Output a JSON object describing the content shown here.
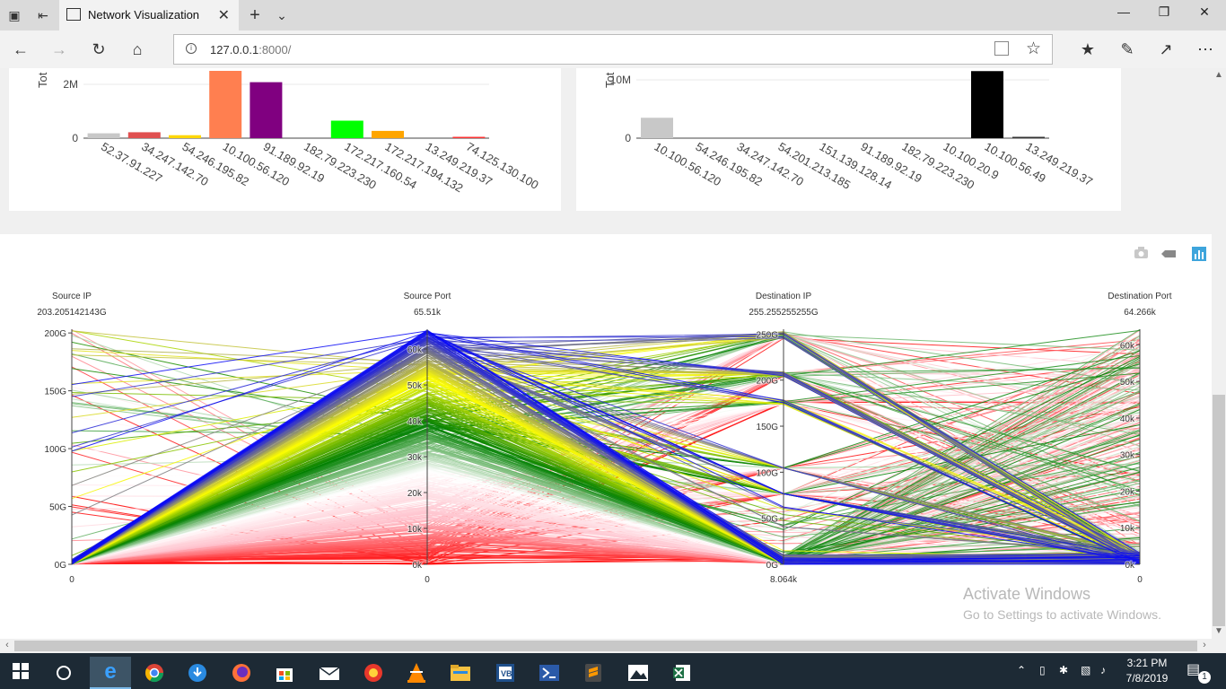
{
  "browser": {
    "tab_title": "Network Visualization",
    "url_host": "127.0.0.1",
    "url_path": ":8000/"
  },
  "chart_data": [
    {
      "type": "bar",
      "ylabel": "Tot",
      "y_ticks": [
        "2M",
        "0"
      ],
      "ylim": [
        0,
        2500000
      ],
      "categories": [
        "52.37.91.227",
        "34.247.142.70",
        "54.246.195.82",
        "10.100.56.120",
        "91.189.92.19",
        "182.79.223.230",
        "172.217.160.54",
        "172.217.194.132",
        "13.249.219.37",
        "74.125.130.100"
      ],
      "values": [
        180000,
        220000,
        110000,
        2500000,
        2080000,
        0,
        650000,
        270000,
        0,
        20000
      ],
      "colors": [
        "#c8c8c8",
        "#e05050",
        "#ffd700",
        "#ff7f50",
        "#800080",
        "#d0d0d0",
        "#00ff00",
        "#ffa500",
        "#cccccc",
        "#ff3333"
      ]
    },
    {
      "type": "bar",
      "ylabel": "Tot",
      "y_ticks": [
        "10M",
        "0"
      ],
      "ylim": [
        0,
        11500000
      ],
      "categories": [
        "10.100.56.120",
        "54.246.195.82",
        "34.247.142.70",
        "54.201.213.185",
        "151.139.128.14",
        "91.189.92.19",
        "182.79.223.230",
        "10.100.20.9",
        "10.100.56.49",
        "13.249.219.37"
      ],
      "values": [
        3500000,
        0,
        0,
        0,
        0,
        50000,
        0,
        0,
        11500000,
        80000
      ],
      "colors": [
        "#c8c8c8",
        "#cccccc",
        "#cccccc",
        "#cccccc",
        "#cccccc",
        "#999999",
        "#cccccc",
        "#cccccc",
        "#000000",
        "#333333"
      ]
    },
    {
      "type": "parallel_coordinates",
      "dimensions": [
        {
          "label": "Source IP",
          "top": "203.205142143G",
          "bottom": "0",
          "ticks": [
            "200G",
            "150G",
            "100G",
            "50G",
            "0G"
          ],
          "tick_values": [
            200,
            150,
            100,
            50,
            0
          ],
          "max": 203.205142143
        },
        {
          "label": "Source Port",
          "top": "65.51k",
          "bottom": "0",
          "ticks": [
            "60k",
            "50k",
            "40k",
            "30k",
            "20k",
            "10k",
            "0k"
          ],
          "tick_values": [
            60,
            50,
            40,
            30,
            20,
            10,
            0
          ],
          "max": 65.51
        },
        {
          "label": "Destination IP",
          "top": "255.255255255G",
          "bottom": "8.064k",
          "ticks": [
            "250G",
            "200G",
            "150G",
            "100G",
            "50G",
            "0G"
          ],
          "tick_values": [
            250,
            200,
            150,
            100,
            50,
            0
          ],
          "max": 255.255255255
        },
        {
          "label": "Destination Port",
          "top": "64.266k",
          "bottom": "0",
          "ticks": [
            "60k",
            "50k",
            "40k",
            "30k",
            "20k",
            "10k",
            "0k"
          ],
          "tick_values": [
            60,
            50,
            40,
            30,
            20,
            10,
            0
          ],
          "max": 64.266
        }
      ],
      "colorscale": [
        "#ff0000",
        "#ffc0cb",
        "#ffffff",
        "#008000",
        "#ffff00",
        "#0000ff"
      ]
    }
  ],
  "modebar": [
    "camera-icon",
    "eraser-icon",
    "plotly-logo-icon"
  ],
  "watermark": {
    "line1": "Activate Windows",
    "line2": "Go to Settings to activate Windows."
  },
  "clock": {
    "time": "3:21 PM",
    "date": "7/8/2019"
  },
  "notification_count": "1"
}
